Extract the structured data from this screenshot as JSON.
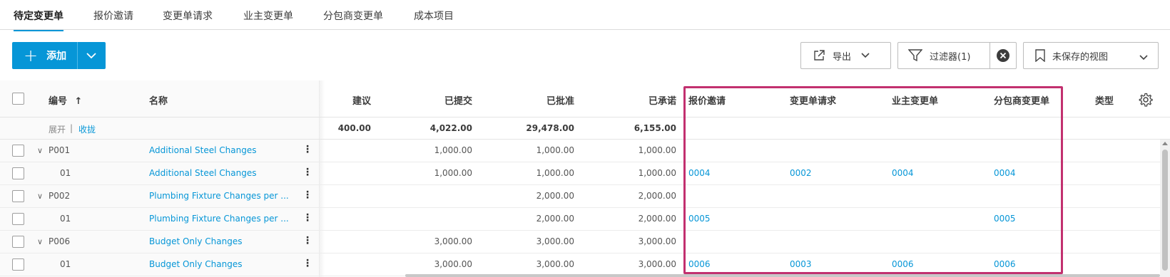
{
  "tabs": [
    {
      "label": "待定变更单",
      "active": true
    },
    {
      "label": "报价邀请"
    },
    {
      "label": "变更单请求"
    },
    {
      "label": "业主变更单"
    },
    {
      "label": "分包商变更单"
    },
    {
      "label": "成本项目"
    }
  ],
  "toolbar": {
    "add_label": "添加",
    "export_label": "导出",
    "filter_label": "过滤器(1)",
    "view_label": "未保存的视图"
  },
  "columns": {
    "number": "编号",
    "name": "名称",
    "proposed": "建议",
    "submitted": "已提交",
    "approved": "已批准",
    "committed": "已承诺",
    "rfq": "报价邀请",
    "cor": "变更单请求",
    "oco": "业主变更单",
    "sco": "分包商变更单",
    "type": "类型"
  },
  "summary": {
    "expand": "展开",
    "separator": "|",
    "collapse": "收拢",
    "proposed": "400.00",
    "submitted": "4,022.00",
    "approved": "29,478.00",
    "committed": "6,155.00"
  },
  "rows": [
    {
      "number": "P001",
      "name": "Additional Steel Changes",
      "submitted": "1,000.00",
      "approved": "1,000.00",
      "committed": "1,000.00",
      "rfq": "",
      "cor": "",
      "oco": "",
      "sco": "",
      "group": true
    },
    {
      "number": "01",
      "name": "Additional Steel Changes",
      "submitted": "1,000.00",
      "approved": "1,000.00",
      "committed": "1,000.00",
      "rfq": "0004",
      "cor": "0002",
      "oco": "0004",
      "sco": "0004",
      "group": false
    },
    {
      "number": "P002",
      "name": "Plumbing Fixture Changes per ...",
      "submitted": "",
      "approved": "2,000.00",
      "committed": "2,000.00",
      "rfq": "",
      "cor": "",
      "oco": "",
      "sco": "",
      "group": true
    },
    {
      "number": "01",
      "name": "Plumbing Fixture Changes per ...",
      "submitted": "",
      "approved": "2,000.00",
      "committed": "2,000.00",
      "rfq": "0005",
      "cor": "",
      "oco": "",
      "sco": "0005",
      "group": false
    },
    {
      "number": "P006",
      "name": "Budget Only Changes",
      "submitted": "3,000.00",
      "approved": "3,000.00",
      "committed": "3,000.00",
      "rfq": "",
      "cor": "",
      "oco": "",
      "sco": "",
      "group": true
    },
    {
      "number": "01",
      "name": "Budget Only Changes",
      "submitted": "3,000.00",
      "approved": "3,000.00",
      "committed": "3,000.00",
      "rfq": "0006",
      "cor": "0003",
      "oco": "0006",
      "sco": "0006",
      "group": false
    }
  ],
  "colors": {
    "accent": "#0696d7",
    "highlight": "#c2306f"
  }
}
